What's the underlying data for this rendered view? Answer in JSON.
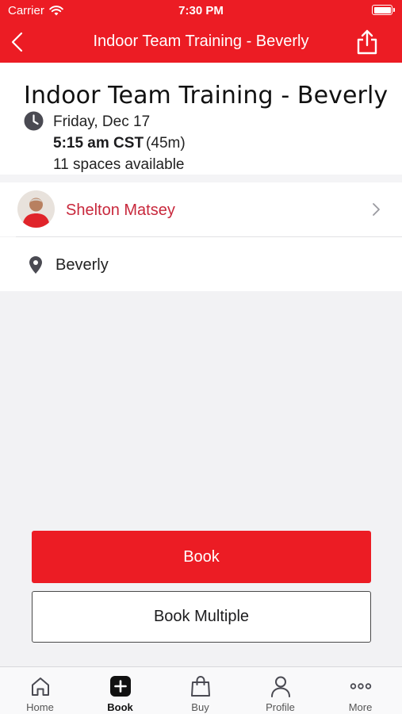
{
  "status_bar": {
    "carrier": "Carrier",
    "time": "7:30 PM"
  },
  "header": {
    "title": "Indoor Team Training - Beverly"
  },
  "class": {
    "title": "Indoor Team Training - Beverly",
    "date": "Friday, Dec 17",
    "time": "5:15 am CST",
    "duration": "(45m)",
    "spaces": "11 spaces available"
  },
  "instructor": {
    "name": "Shelton Matsey"
  },
  "location": {
    "name": "Beverly"
  },
  "actions": {
    "book_label": "Book",
    "book_multiple_label": "Book Multiple"
  },
  "tabs": [
    {
      "label": "Home",
      "icon": "home-icon",
      "active": false
    },
    {
      "label": "Book",
      "icon": "book-plus-icon",
      "active": true
    },
    {
      "label": "Buy",
      "icon": "shopping-bag-icon",
      "active": false
    },
    {
      "label": "Profile",
      "icon": "person-icon",
      "active": false
    },
    {
      "label": "More",
      "icon": "more-dots-icon",
      "active": false
    }
  ],
  "colors": {
    "brand": "#ec1c24",
    "instructor_link": "#c8283c"
  }
}
